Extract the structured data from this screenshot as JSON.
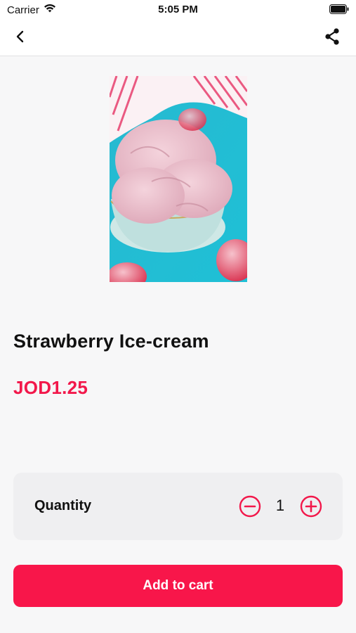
{
  "status_bar": {
    "carrier": "Carrier",
    "time": "5:05 PM",
    "icons": [
      "wifi-icon",
      "battery-icon"
    ]
  },
  "nav": {
    "back_icon": "chevron-left-icon",
    "share_icon": "share-icon"
  },
  "product": {
    "image": "strawberry-ice-cream-photo",
    "title": "Strawberry Ice-cream",
    "price": "JOD1.25"
  },
  "quantity": {
    "label": "Quantity",
    "value": "1",
    "minus_icon": "minus-circle-icon",
    "plus_icon": "plus-circle-icon"
  },
  "actions": {
    "add_to_cart": "Add to cart"
  },
  "colors": {
    "accent": "#f8164a",
    "price": "#f2184b",
    "background": "#f7f7f8",
    "card": "#efeff1"
  }
}
